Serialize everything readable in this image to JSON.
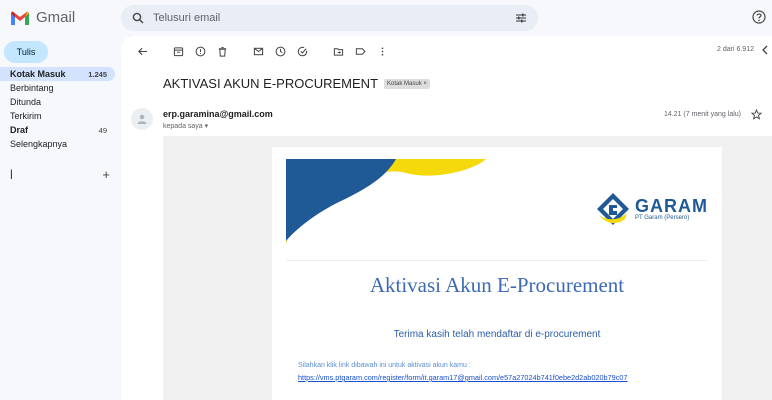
{
  "app": {
    "name": "Gmail"
  },
  "search": {
    "placeholder": "Telusuri email"
  },
  "sidebar": {
    "compose_label": "Tulis",
    "items": [
      {
        "label": "Kotak Masuk",
        "count": "1.245"
      },
      {
        "label": "Berbintang",
        "count": ""
      },
      {
        "label": "Ditunda",
        "count": ""
      },
      {
        "label": "Terkirim",
        "count": ""
      },
      {
        "label": "Draf",
        "count": "49"
      },
      {
        "label": "Selengkapnya",
        "count": ""
      }
    ],
    "labels_heading": "l",
    "labels_add": "+"
  },
  "toolbar": {
    "pager_text": "2 dari 6.912"
  },
  "email": {
    "subject": "AKTIVASI AKUN E-PROCUREMENT",
    "tag": "Kotak Masuk ×",
    "sender": "erp.garamina@gmail.com",
    "to": "kepada saya ▾",
    "time": "14.21 (7 menit yang lalu)"
  },
  "message": {
    "brand_title": "GARAM",
    "brand_sub": "PT Garam (Persero)",
    "headline": "Aktivasi Akun E-Procurement",
    "thanks": "Terima kasih telah mendaftar di e-procurement",
    "instruction": "Silahkan klik link dibawah ini untuk aktivasi akun kamu :",
    "link": "https://vms.ptgaram.com/register/form/it.garam17@gmail.com/e57a27024b741f0ebe2d2ab020b79c07"
  },
  "colors": {
    "accent": "#c2e7ff",
    "active": "#d3e3fd",
    "brand_blue": "#1f5a96",
    "brand_yellow": "#f5d90a"
  }
}
